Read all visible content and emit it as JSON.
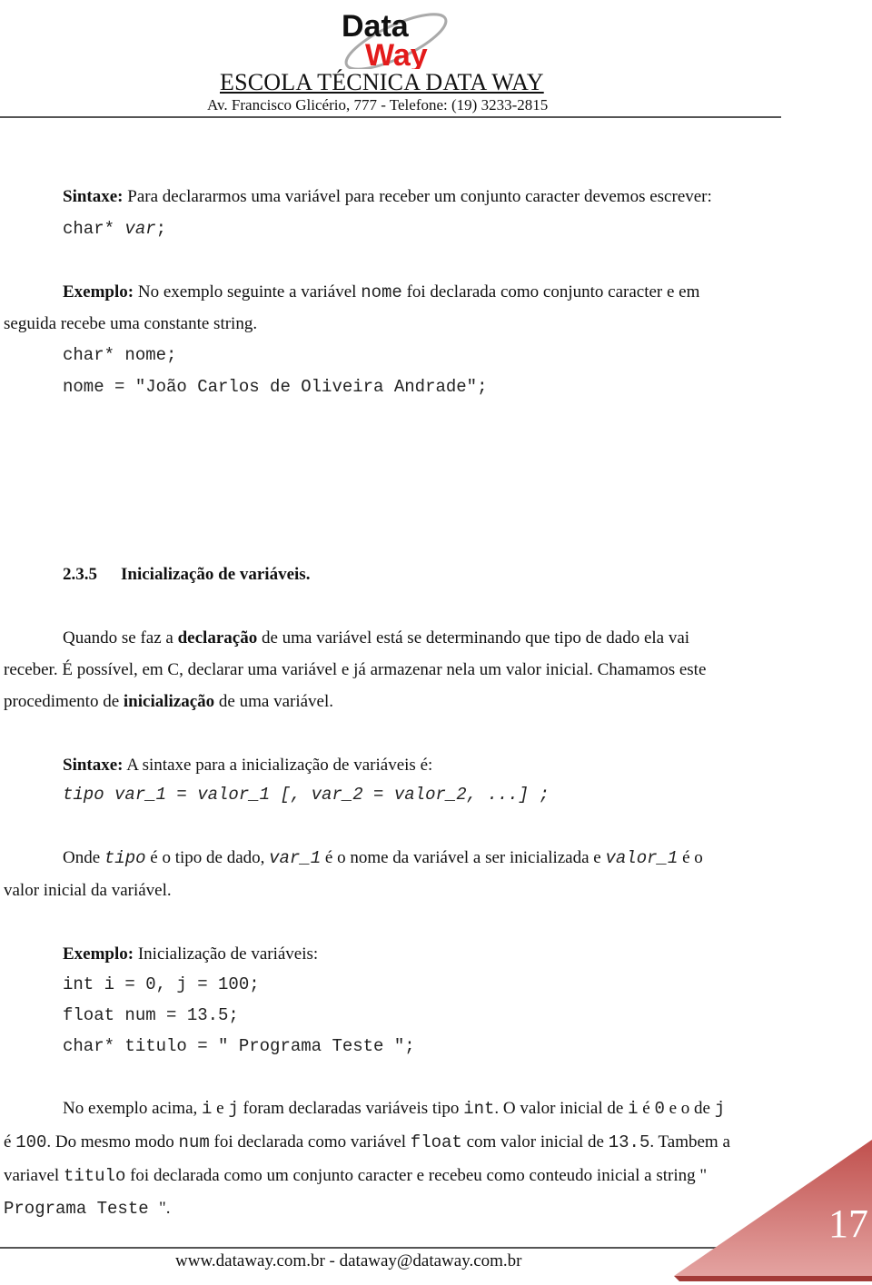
{
  "header": {
    "logo_line1": "Data",
    "logo_line2": "Way",
    "school_name": "ESCOLA TÉCNICA DATA WAY",
    "address": "Av. Francisco Glicério, 777 - Telefone: (19) 3233-2815"
  },
  "syntax1": {
    "label": "Sintaxe:",
    "text": " Para declararmos uma variável para receber um conjunto caracter devemos escrever:",
    "code_type": "char* ",
    "code_var": "var",
    "code_end": ";"
  },
  "example1": {
    "label": "Exemplo:",
    "text_a": " No exemplo seguinte a variável ",
    "code_nome": "nome",
    "text_b": " foi declarada como conjunto caracter e em",
    "text_c": "seguida recebe uma constante string.",
    "code_line1": "char* nome;",
    "code_line2": "nome = \"João Carlos de Oliveira Andrade\";"
  },
  "section": {
    "number": "2.3.5",
    "title": "Inicialização de variáveis."
  },
  "paragraph1": {
    "line1_a": "Quando se faz a ",
    "line1_bold": "declaração",
    "line1_b": " de uma variável está se determinando que tipo de dado ela vai",
    "line2": "receber. É possível, em C, declarar uma variável e já armazenar nela um valor inicial. Chamamos este",
    "line3_a": "procedimento de ",
    "line3_bold": "inicialização",
    "line3_b": " de uma variável."
  },
  "syntax2": {
    "label": "Sintaxe:",
    "text": " A sintaxe para a inicialização de variáveis é:",
    "code": "tipo var_1 = valor_1 [, var_2 = valor_2, ...] ;"
  },
  "paragraph2": {
    "t1": "Onde ",
    "c1": "tipo",
    "t2": " é o tipo de dado, ",
    "c2": "var_1",
    "t3": " é o nome da variável a ser inicializada e ",
    "c3": "valor_1",
    "t4": " é o",
    "line2": "valor inicial da variável."
  },
  "example2": {
    "label": "Exemplo:",
    "text": " Inicialização de variáveis:",
    "code_lines": [
      "int i = 0, j = 100;",
      "float num = 13.5;",
      "char* titulo = \" Programa Teste \";"
    ]
  },
  "paragraph3": {
    "l1": [
      "No exemplo acima, ",
      "i",
      " e ",
      "j",
      "  foram declaradas variáveis tipo ",
      "int",
      ". O valor inicial de ",
      "i",
      " é ",
      "0",
      " e o de ",
      "j"
    ],
    "l2": [
      "é ",
      "100",
      ". Do mesmo modo ",
      "num",
      " foi declarada como variável ",
      "float",
      " com valor inicial de ",
      "13.5",
      ". Tambem a"
    ],
    "l3": [
      "variavel ",
      "titulo",
      " foi declarada como um conjunto caracter e recebeu como conteudo inicial a string \""
    ],
    "l4": [
      "Programa Teste ",
      "\"."
    ]
  },
  "footer": {
    "text": "www.dataway.com.br - dataway@dataway.com.br",
    "page_number": "17"
  },
  "colors": {
    "logo_red": "#e31b1b",
    "corner_red": "#c0504d"
  }
}
